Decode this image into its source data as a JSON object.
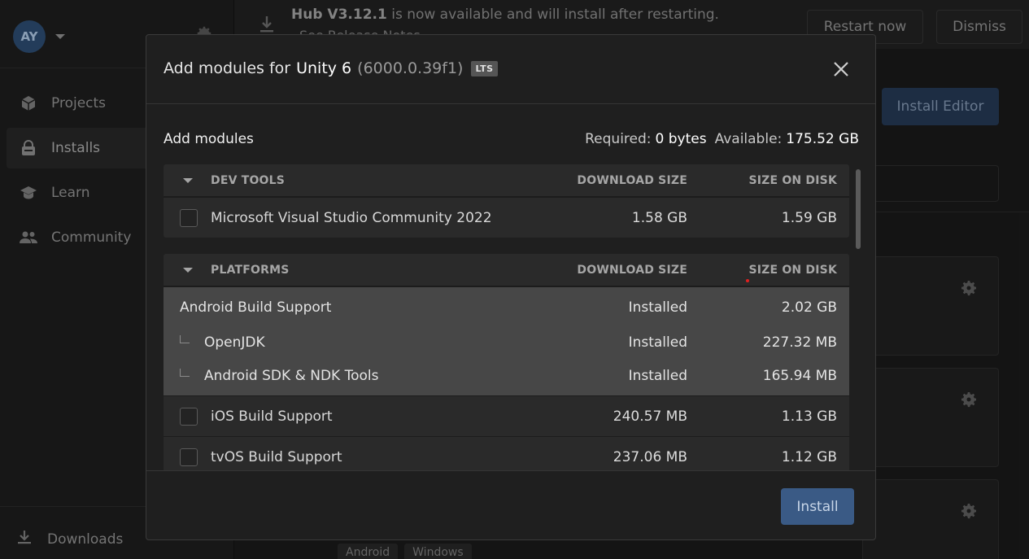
{
  "sidebar": {
    "account_initials": "AY",
    "nav": [
      {
        "label": "Projects",
        "icon": "cube-icon"
      },
      {
        "label": "Installs",
        "icon": "lock-icon"
      },
      {
        "label": "Learn",
        "icon": "graduation-cap-icon"
      },
      {
        "label": "Community",
        "icon": "people-icon"
      }
    ],
    "downloads_label": "Downloads"
  },
  "banner": {
    "product": "Hub V3.12.1",
    "message": " is now available and will install after restarting.",
    "release_notes": "See Release Notes",
    "restart_label": "Restart now",
    "dismiss_label": "Dismiss"
  },
  "main": {
    "install_editor_label": "Install Editor",
    "tags": [
      "Android",
      "Windows"
    ]
  },
  "modal": {
    "title_prefix": "Add modules for",
    "editor_name": "Unity 6",
    "editor_version": "(6000.0.39f1)",
    "badge": "LTS",
    "section_title": "Add modules",
    "required_label": "Required:",
    "required_value": "0 bytes",
    "available_label": "Available:",
    "available_value": "175.52 GB",
    "install_label": "Install",
    "groups": [
      {
        "name": "DEV TOOLS",
        "col_download": "DOWNLOAD SIZE",
        "col_disk": "SIZE ON DISK",
        "rows": [
          {
            "name": "Microsoft Visual Studio Community 2022",
            "download": "1.58 GB",
            "disk": "1.59 GB",
            "checked": false
          }
        ]
      },
      {
        "name": "PLATFORMS",
        "col_download": "DOWNLOAD SIZE",
        "col_disk": "SIZE ON DISK",
        "installed": [
          {
            "name": "Android Build Support",
            "download": "Installed",
            "disk": "2.02 GB"
          },
          {
            "name": "OpenJDK",
            "download": "Installed",
            "disk": "227.32 MB"
          },
          {
            "name": "Android SDK & NDK Tools",
            "download": "Installed",
            "disk": "165.94 MB"
          }
        ],
        "rows": [
          {
            "name": "iOS Build Support",
            "download": "240.57 MB",
            "disk": "1.13 GB",
            "checked": false
          },
          {
            "name": "tvOS Build Support",
            "download": "237.06 MB",
            "disk": "1.12 GB",
            "checked": false
          }
        ]
      }
    ]
  }
}
